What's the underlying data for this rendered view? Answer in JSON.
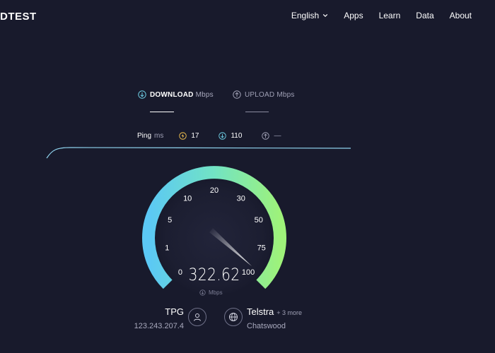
{
  "header": {
    "logo": "DTEST",
    "nav": [
      "English",
      "Apps",
      "Learn",
      "Data",
      "About"
    ]
  },
  "tabs": {
    "download": {
      "label": "DOWNLOAD",
      "unit": "Mbps"
    },
    "upload": {
      "label": "UPLOAD",
      "unit": "Mbps"
    }
  },
  "ping": {
    "label": "Ping",
    "unit": "ms",
    "idle": "17",
    "download": "110",
    "upload": "—"
  },
  "gauge": {
    "ticks": [
      "0",
      "1",
      "5",
      "10",
      "20",
      "30",
      "50",
      "75",
      "100"
    ],
    "value": "322.62",
    "unit": "Mbps"
  },
  "isp": {
    "name": "TPG",
    "ip": "123.243.207.4"
  },
  "server": {
    "name": "Telstra",
    "more": "+ 3 more",
    "location": "Chatswood"
  },
  "colors": {
    "background": "#181a2c",
    "gauge_start": "#5bc8f5",
    "gauge_end": "#9ef27a",
    "graph_line": "#8fd3ee"
  }
}
